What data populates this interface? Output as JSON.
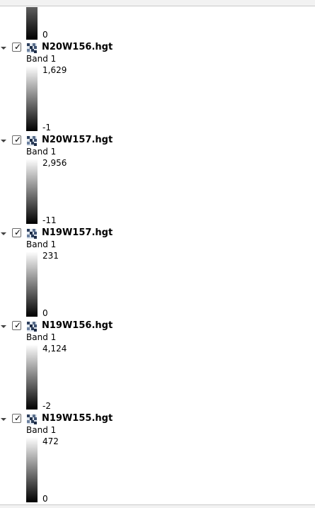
{
  "partial_layer": {
    "min_label": "0"
  },
  "layers": [
    {
      "name": "N20W156.hgt",
      "band": "Band 1",
      "max": "1,629",
      "min": "-1",
      "checked": true,
      "expanded": true,
      "icon": "raster-layer-icon"
    },
    {
      "name": "N20W157.hgt",
      "band": "Band 1",
      "max": "2,956",
      "min": "-11",
      "checked": true,
      "expanded": true,
      "icon": "raster-layer-icon"
    },
    {
      "name": "N19W157.hgt",
      "band": "Band 1",
      "max": "231",
      "min": "0",
      "checked": true,
      "expanded": true,
      "icon": "raster-layer-icon"
    },
    {
      "name": "N19W156.hgt",
      "band": "Band 1",
      "max": "4,124",
      "min": "-2",
      "checked": true,
      "expanded": true,
      "icon": "raster-layer-icon"
    },
    {
      "name": "N19W155.hgt",
      "band": "Band 1",
      "max": "472",
      "min": "0",
      "checked": true,
      "expanded": true,
      "icon": "raster-layer-icon"
    }
  ],
  "colors": {
    "ramp_top": "#ffffff",
    "ramp_bottom": "#000000"
  }
}
